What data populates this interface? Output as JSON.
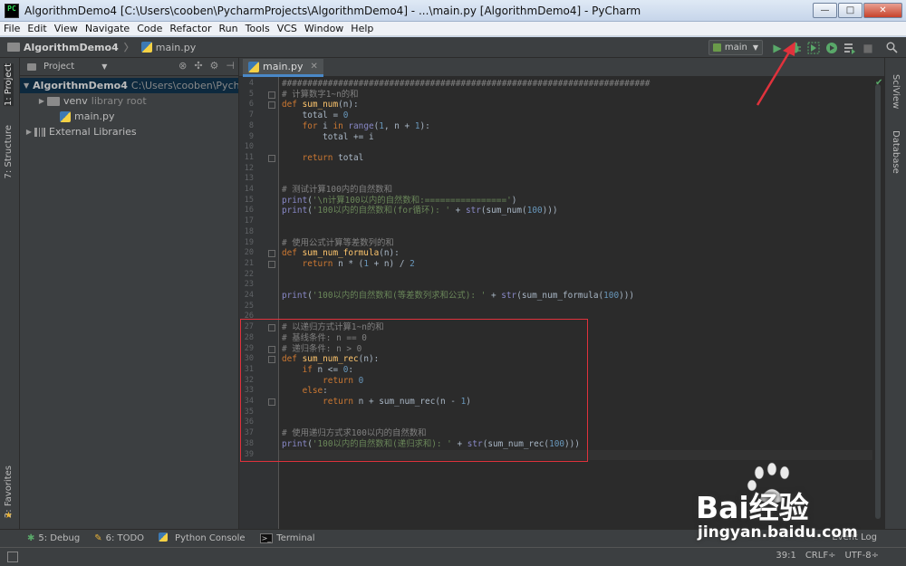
{
  "window": {
    "title": "AlgorithmDemo4 [C:\\Users\\cooben\\PycharmProjects\\AlgorithmDemo4] - ...\\main.py [AlgorithmDemo4] - PyCharm",
    "app_icon_text": "PC",
    "minimize": "—",
    "maximize": "□",
    "close": "✕"
  },
  "menu": [
    "File",
    "Edit",
    "View",
    "Navigate",
    "Code",
    "Refactor",
    "Run",
    "Tools",
    "VCS",
    "Window",
    "Help"
  ],
  "navbar": {
    "project": "AlgorithmDemo4",
    "file": "main.py",
    "run_config": "main",
    "icons": [
      "run-icon",
      "debug-icon",
      "coverage-icon",
      "profile-icon",
      "build-icon",
      "stop-icon",
      "search-icon"
    ]
  },
  "left_stripe": {
    "project_tab": "1: Project",
    "structure_tab": "7: Structure",
    "favorites_tab": "2: Favorites"
  },
  "project_panel": {
    "view": "Project",
    "tree": [
      {
        "label": "AlgorithmDemo4",
        "muted": "C:\\Users\\cooben\\PycharmProjects",
        "level": 0,
        "expanded": true,
        "bold": true,
        "selected": true,
        "icon": "folder-icon"
      },
      {
        "label": "venv",
        "muted": "library root",
        "level": 1,
        "expanded": false,
        "icon": "folder-icon"
      },
      {
        "label": "main.py",
        "muted": "",
        "level": 2,
        "expanded": null,
        "icon": "python-file-icon"
      },
      {
        "label": "External Libraries",
        "muted": "",
        "level": 0,
        "expanded": false,
        "icon": "library-icon"
      }
    ]
  },
  "editor": {
    "tab": "main.py",
    "lines": [
      {
        "n": "4",
        "fold": false,
        "tokens": [
          [
            "com",
            "########################################################################"
          ]
        ]
      },
      {
        "n": "5",
        "fold": true,
        "tokens": [
          [
            "com",
            "# 计算数字1~n的和"
          ]
        ]
      },
      {
        "n": "6",
        "fold": true,
        "tokens": [
          [
            "kw",
            "def "
          ],
          [
            "fn",
            "sum_num"
          ],
          [
            "txt",
            "(n):"
          ]
        ]
      },
      {
        "n": "7",
        "fold": false,
        "tokens": [
          [
            "txt",
            "    total = "
          ],
          [
            "num",
            "0"
          ]
        ]
      },
      {
        "n": "8",
        "fold": false,
        "tokens": [
          [
            "txt",
            "    "
          ],
          [
            "kw",
            "for "
          ],
          [
            "txt",
            "i "
          ],
          [
            "kw",
            "in "
          ],
          [
            "bi",
            "range"
          ],
          [
            "txt",
            "("
          ],
          [
            "num",
            "1"
          ],
          [
            "txt",
            ", n + "
          ],
          [
            "num",
            "1"
          ],
          [
            "txt",
            "):"
          ]
        ]
      },
      {
        "n": "9",
        "fold": false,
        "tokens": [
          [
            "txt",
            "        total += i"
          ]
        ]
      },
      {
        "n": "10",
        "fold": false,
        "tokens": []
      },
      {
        "n": "11",
        "fold": true,
        "tokens": [
          [
            "txt",
            "    "
          ],
          [
            "kw",
            "return "
          ],
          [
            "txt",
            "total"
          ]
        ]
      },
      {
        "n": "12",
        "fold": false,
        "tokens": []
      },
      {
        "n": "13",
        "fold": false,
        "tokens": []
      },
      {
        "n": "14",
        "fold": false,
        "tokens": [
          [
            "com",
            "# 测试计算100内的自然数和"
          ]
        ]
      },
      {
        "n": "15",
        "fold": false,
        "tokens": [
          [
            "bi",
            "print"
          ],
          [
            "txt",
            "("
          ],
          [
            "str",
            "'\\n计算100以内的自然数和:================'"
          ],
          [
            "txt",
            ")"
          ]
        ]
      },
      {
        "n": "16",
        "fold": false,
        "tokens": [
          [
            "bi",
            "print"
          ],
          [
            "txt",
            "("
          ],
          [
            "str",
            "'100以内的自然数和(for循环): '"
          ],
          [
            "txt",
            " + "
          ],
          [
            "bi",
            "str"
          ],
          [
            "txt",
            "(sum_num("
          ],
          [
            "num",
            "100"
          ],
          [
            "txt",
            ")))"
          ]
        ]
      },
      {
        "n": "17",
        "fold": false,
        "tokens": []
      },
      {
        "n": "18",
        "fold": false,
        "tokens": []
      },
      {
        "n": "19",
        "fold": false,
        "tokens": [
          [
            "com",
            "# 使用公式计算等差数列的和"
          ]
        ]
      },
      {
        "n": "20",
        "fold": true,
        "tokens": [
          [
            "kw",
            "def "
          ],
          [
            "fn",
            "sum_num_formula"
          ],
          [
            "txt",
            "(n):"
          ]
        ]
      },
      {
        "n": "21",
        "fold": true,
        "tokens": [
          [
            "txt",
            "    "
          ],
          [
            "kw",
            "return "
          ],
          [
            "txt",
            "n * ("
          ],
          [
            "num",
            "1"
          ],
          [
            "txt",
            " + n) / "
          ],
          [
            "num",
            "2"
          ]
        ]
      },
      {
        "n": "22",
        "fold": false,
        "tokens": []
      },
      {
        "n": "23",
        "fold": false,
        "tokens": []
      },
      {
        "n": "24",
        "fold": false,
        "tokens": [
          [
            "bi",
            "print"
          ],
          [
            "txt",
            "("
          ],
          [
            "str",
            "'100以内的自然数和(等差数列求和公式): '"
          ],
          [
            "txt",
            " + "
          ],
          [
            "bi",
            "str"
          ],
          [
            "txt",
            "(sum_num_formula("
          ],
          [
            "num",
            "100"
          ],
          [
            "txt",
            ")))"
          ]
        ]
      },
      {
        "n": "25",
        "fold": false,
        "tokens": []
      },
      {
        "n": "26",
        "fold": false,
        "tokens": []
      },
      {
        "n": "27",
        "fold": true,
        "tokens": [
          [
            "com",
            "# 以递归方式计算1~n的和"
          ]
        ]
      },
      {
        "n": "28",
        "fold": false,
        "tokens": [
          [
            "com",
            "# 基线条件: n == 0"
          ]
        ]
      },
      {
        "n": "29",
        "fold": true,
        "tokens": [
          [
            "com",
            "# 递归条件: n > 0"
          ]
        ]
      },
      {
        "n": "30",
        "fold": true,
        "tokens": [
          [
            "kw",
            "def "
          ],
          [
            "fn",
            "sum_num_rec"
          ],
          [
            "txt",
            "(n):"
          ]
        ]
      },
      {
        "n": "31",
        "fold": false,
        "tokens": [
          [
            "txt",
            "    "
          ],
          [
            "kw",
            "if "
          ],
          [
            "txt",
            "n <= "
          ],
          [
            "num",
            "0"
          ],
          [
            "txt",
            ":"
          ]
        ]
      },
      {
        "n": "32",
        "fold": false,
        "tokens": [
          [
            "txt",
            "        "
          ],
          [
            "kw",
            "return "
          ],
          [
            "num",
            "0"
          ]
        ]
      },
      {
        "n": "33",
        "fold": false,
        "tokens": [
          [
            "txt",
            "    "
          ],
          [
            "kw",
            "else"
          ],
          [
            "txt",
            ":"
          ]
        ]
      },
      {
        "n": "34",
        "fold": true,
        "tokens": [
          [
            "txt",
            "        "
          ],
          [
            "kw",
            "return "
          ],
          [
            "txt",
            "n + sum_num_rec(n - "
          ],
          [
            "num",
            "1"
          ],
          [
            "txt",
            ")"
          ]
        ]
      },
      {
        "n": "35",
        "fold": false,
        "tokens": []
      },
      {
        "n": "36",
        "fold": false,
        "tokens": []
      },
      {
        "n": "37",
        "fold": false,
        "tokens": [
          [
            "com",
            "# 使用递归方式求100以内的自然数和"
          ]
        ]
      },
      {
        "n": "38",
        "fold": false,
        "tokens": [
          [
            "bi",
            "print"
          ],
          [
            "txt",
            "("
          ],
          [
            "str",
            "'100以内的自然数和(递归求和): '"
          ],
          [
            "txt",
            " + "
          ],
          [
            "bi",
            "str"
          ],
          [
            "txt",
            "(sum_num_rec("
          ],
          [
            "num",
            "100"
          ],
          [
            "txt",
            ")))"
          ]
        ]
      },
      {
        "n": "39",
        "fold": false,
        "tokens": []
      }
    ],
    "current_line": "39"
  },
  "right_stripe": {
    "sciview": "SciView",
    "database": "Database"
  },
  "bottom_tools": [
    {
      "icon": "debug-icon",
      "label": "5: Debug"
    },
    {
      "icon": "todo-icon",
      "label": "6: TODO"
    },
    {
      "icon": "python-console-icon",
      "label": "Python Console"
    },
    {
      "icon": "terminal-icon",
      "label": "Terminal"
    }
  ],
  "event_log": "Event Log",
  "status": {
    "position": "39:1",
    "line_sep": "CRLF÷",
    "encoding": "UTF-8÷"
  },
  "watermark": {
    "brand": "Bai经验",
    "url": "jingyan.baidu.com"
  },
  "colors": {
    "editor_bg": "#2b2b2b",
    "panel_bg": "#3c3f41",
    "highlight": "#e0323c",
    "keyword": "#cc7832",
    "function": "#ffc66d",
    "string": "#6a8759",
    "number": "#6897bb",
    "comment": "#808080"
  }
}
